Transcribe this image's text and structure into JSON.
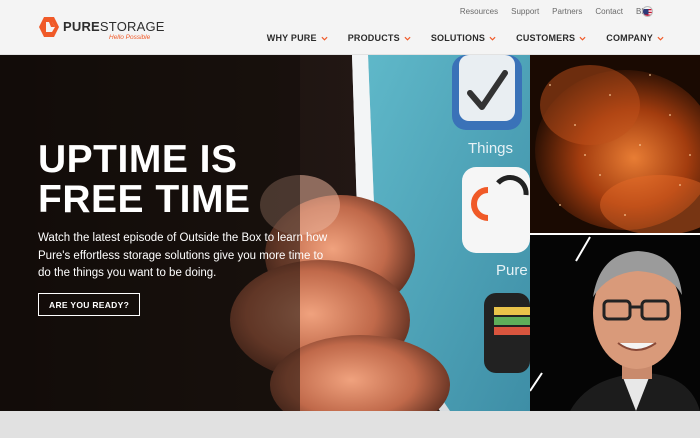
{
  "brand": {
    "name_bold": "PURE",
    "name_light": "STORAGE",
    "tagline": "Hello Possible",
    "accent": "#f05a28"
  },
  "utility_nav": [
    "Resources",
    "Support",
    "Partners",
    "Contact",
    "Blog"
  ],
  "main_nav": [
    {
      "label": "WHY PURE",
      "icon": "chevron-down-icon"
    },
    {
      "label": "PRODUCTS",
      "icon": "chevron-down-icon"
    },
    {
      "label": "SOLUTIONS",
      "icon": "chevron-down-icon"
    },
    {
      "label": "CUSTOMERS",
      "icon": "chevron-down-icon"
    },
    {
      "label": "COMPANY",
      "icon": "chevron-down-icon"
    }
  ],
  "hero": {
    "title": "UPTIME IS\nFREE TIME",
    "subtitle": "Watch the latest episode of Outside the Box to learn how Pure's effortless storage solutions give you more time to do the things you want to be doing.",
    "cta_label": "ARE YOU READY?",
    "app_labels": [
      "Things",
      "Pure"
    ]
  },
  "colors": {
    "header_bg": "#f4f4f4",
    "hero_bg": "#1b1311",
    "nav_text": "#2b2b2b",
    "caret": "#f05a28"
  }
}
